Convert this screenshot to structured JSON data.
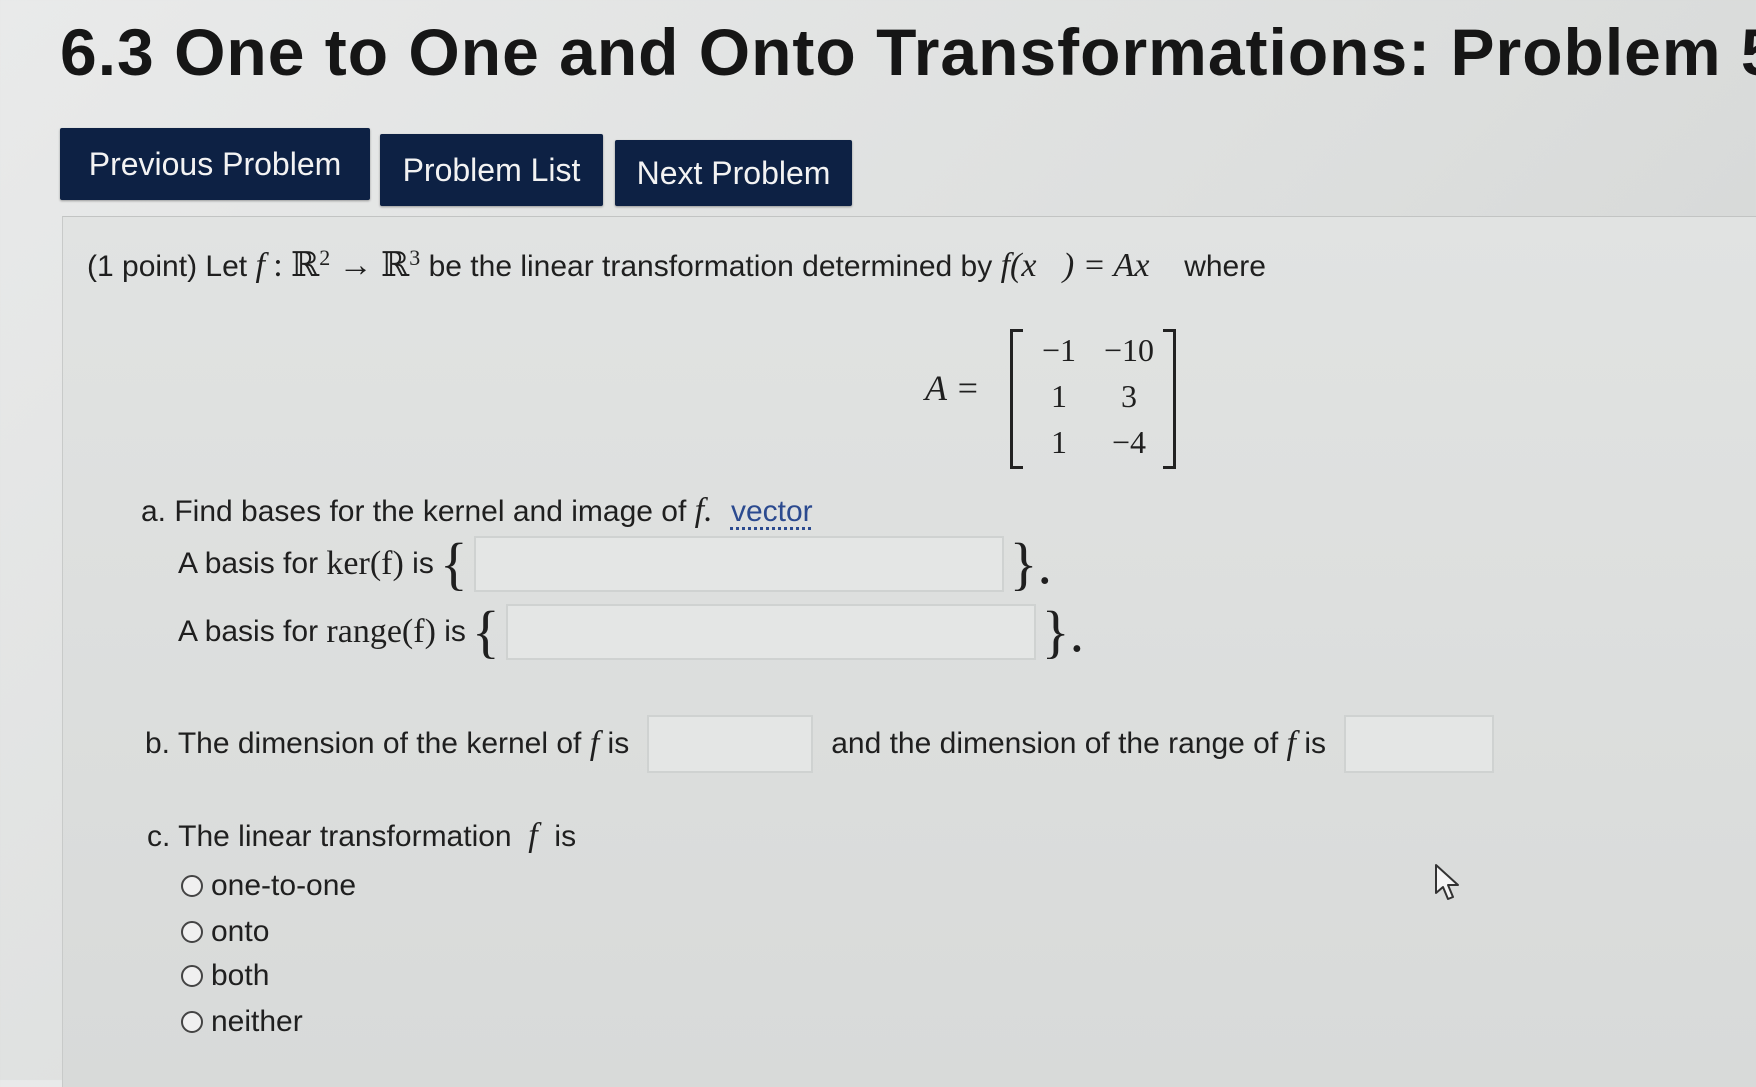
{
  "page": {
    "title": "6.3 One to One and Onto Transformations: Problem 5"
  },
  "nav": {
    "previous": "Previous Problem",
    "list": "Problem List",
    "next": "Next Problem"
  },
  "problem": {
    "points": "(1 point) Let",
    "f": "f",
    "colon": ":",
    "domain": "ℝ",
    "domain_exp": "2",
    "arrow": "→",
    "codomain": "ℝ",
    "codomain_exp": "3",
    "determined_by": "be the linear transformation determined by",
    "formula": "f(x⃗) = Ax⃗",
    "where": "where",
    "matrix_label": "A =",
    "matrix": [
      "−1",
      "−10",
      "1",
      "3",
      "1",
      "−4"
    ]
  },
  "part_a": {
    "prompt": "a. Find bases for the kernel and image of",
    "f": "f.",
    "link": "vector",
    "ker_prefix": "A basis for",
    "ker_math": "ker(f)",
    "ker_suffix": "is",
    "ker_value": "",
    "rng_prefix": "A basis for",
    "rng_math": "range(f)",
    "rng_suffix": "is",
    "rng_value": "",
    "open_brace": "{",
    "close_brace": "}."
  },
  "part_b": {
    "prefix": "b. The dimension of the kernel of",
    "f": "f",
    "is1": "is",
    "middle": "and the dimension of the range of",
    "is2": "is",
    "ker_dim": "",
    "rng_dim": ""
  },
  "part_c": {
    "prompt": "c. The linear transformation",
    "f": "f",
    "is": "is",
    "options": [
      "one-to-one",
      "onto",
      "both",
      "neither"
    ]
  }
}
